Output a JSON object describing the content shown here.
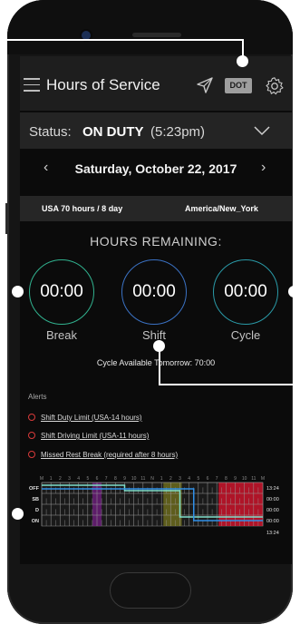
{
  "header": {
    "title": "Hours of Service",
    "dot_badge": "DOT"
  },
  "status": {
    "label": "Status:",
    "value": "ON DUTY",
    "time": "(5:23pm)"
  },
  "date_nav": {
    "prev": "‹",
    "date": "Saturday, October 22, 2017",
    "next": "›"
  },
  "ruleset": {
    "cycle_rule": "USA 70 hours / 8 day",
    "timezone": "America/New_York"
  },
  "hours_remaining": {
    "title": "HOURS REMAINING:",
    "gauges": [
      {
        "label": "Break",
        "value": "00:00",
        "color": "#31b28f"
      },
      {
        "label": "Shift",
        "value": "00:00",
        "color": "#3b72c4"
      },
      {
        "label": "Cycle",
        "value": "00:00",
        "color": "#2a9aa7"
      }
    ],
    "cycle_available": "Cycle Available Tomorrow: 70:00"
  },
  "alerts": {
    "title": "Alerts",
    "items": [
      "Shift Duty Limit (USA-14 hours)",
      "Shift Driving Limit (USA-11 hours)",
      "Missed Rest Break (required after 8 hours)"
    ]
  },
  "log_graph": {
    "hour_labels": [
      "M",
      "1",
      "2",
      "3",
      "4",
      "5",
      "6",
      "7",
      "8",
      "9",
      "10",
      "11",
      "N",
      "1",
      "2",
      "3",
      "4",
      "5",
      "6",
      "7",
      "8",
      "9",
      "10",
      "11",
      "M"
    ],
    "rows": [
      {
        "status": "OFF",
        "total": "13:24"
      },
      {
        "status": "SB",
        "total": "00:00"
      },
      {
        "status": "D",
        "total": "00:00"
      },
      {
        "status": "ON",
        "total": "00:00"
      }
    ],
    "grand_total": "13:24",
    "colors": {
      "off_line": "#7fe0cc",
      "on_line": "#2f8fe8",
      "violation_red": "#c0142a",
      "highlight_purple": "#6a1f78",
      "highlight_olive": "#6b6a1e"
    }
  }
}
